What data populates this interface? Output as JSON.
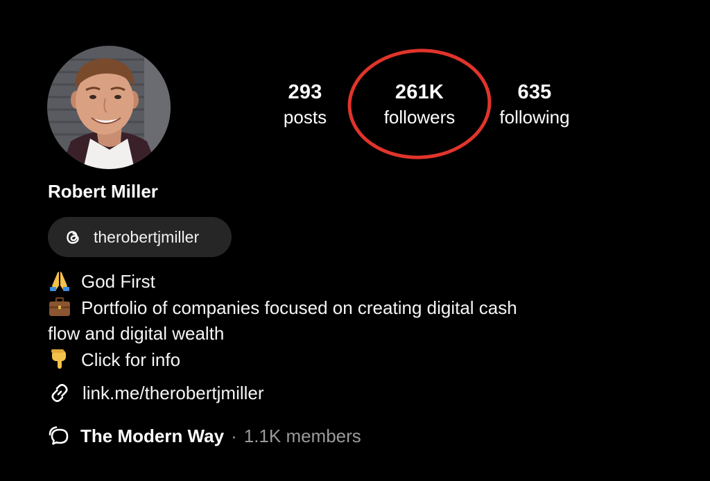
{
  "profile": {
    "name": "Robert Miller",
    "threads_handle": "therobertjmiller",
    "avatar_icon": "profile-photo"
  },
  "stats": {
    "posts": {
      "count": "293",
      "label": "posts"
    },
    "followers": {
      "count": "261K",
      "label": "followers"
    },
    "following": {
      "count": "635",
      "label": "following"
    }
  },
  "highlight": {
    "color": "#e0342b",
    "target": "followers"
  },
  "bio": {
    "line1": {
      "icon": "folded-hands-emoji",
      "text": "God First"
    },
    "line2": {
      "icon": "briefcase-emoji",
      "text": "Portfolio of companies focused on creating digital cash"
    },
    "line3": {
      "text": "flow and digital wealth"
    },
    "line4": {
      "icon": "pointing-down-emoji",
      "text": "Click for info"
    }
  },
  "link": {
    "icon": "link-icon",
    "text": "link.me/therobertjmiller"
  },
  "channel": {
    "icon": "broadcast-channel-icon",
    "name": "The Modern Way",
    "separator": "·",
    "members": "1.1K members"
  },
  "colors": {
    "background": "#000000",
    "pill_background": "#262626",
    "secondary_text": "#9a9a9a",
    "highlight_circle": "#e0342b"
  }
}
